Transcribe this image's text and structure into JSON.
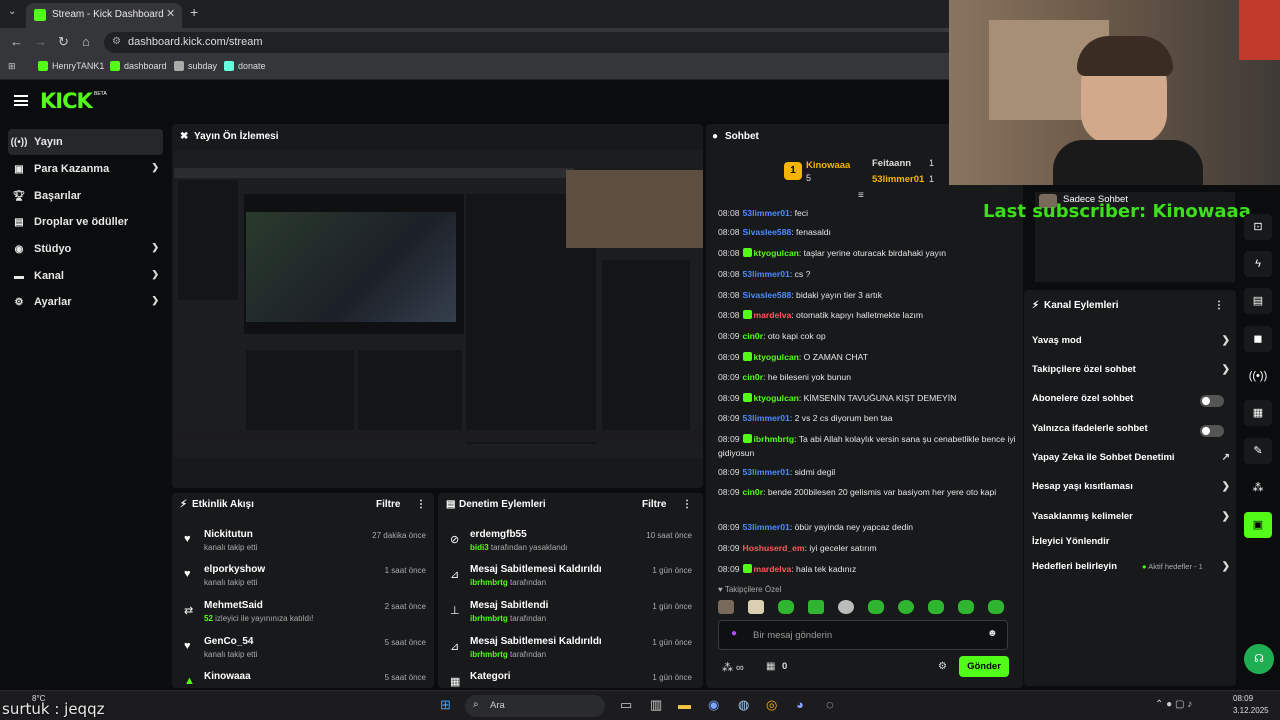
{
  "browser": {
    "tab_title": "Stream - Kick Dashboard",
    "url": "dashboard.kick.com/stream",
    "bookmarks": [
      "HenryTANK1",
      "dashboard",
      "subday",
      "donate"
    ]
  },
  "brand": {
    "logo": "KICK",
    "beta": "BETA",
    "accent": "#53fc18"
  },
  "sidebar": {
    "items": [
      {
        "label": "Yayın",
        "icon": "broadcast-icon",
        "active": true
      },
      {
        "label": "Para Kazanma",
        "icon": "money-icon",
        "chevron": true
      },
      {
        "label": "Başarılar",
        "icon": "trophy-icon"
      },
      {
        "label": "Droplar ve ödüller",
        "icon": "gift-icon"
      },
      {
        "label": "Stüdyo",
        "icon": "studio-icon",
        "chevron": true
      },
      {
        "label": "Kanal",
        "icon": "channel-icon",
        "chevron": true
      },
      {
        "label": "Ayarlar",
        "icon": "gear-icon",
        "chevron": true
      }
    ]
  },
  "preview": {
    "title": "Yayın Ön İzlemesi"
  },
  "activity": {
    "title": "Etkinlik Akışı",
    "filter": "Filtre",
    "rows": [
      {
        "name": "Nickitutun",
        "desc": "kanalı takip etti",
        "time": "27 dakika önce",
        "icon": "heart-icon"
      },
      {
        "name": "elporkyshow",
        "desc": "kanalı takip etti",
        "time": "1 saat önce",
        "icon": "heart-icon"
      },
      {
        "name": "MehmetSaid",
        "count": "52",
        "desc": "izleyici ile yayınınıza katıldı!",
        "time": "2 saat önce",
        "icon": "host-icon"
      },
      {
        "name": "GenCo_54",
        "desc": "kanalı takip etti",
        "time": "5 saat önce",
        "icon": "heart-icon"
      },
      {
        "name": "Kinowaaa",
        "desc": "",
        "time": "5 saat önce",
        "icon": "sub-icon"
      }
    ]
  },
  "moderation": {
    "title": "Denetim Eylemleri",
    "filter": "Filtre",
    "rows": [
      {
        "name": "erdemgfb55",
        "actor": "bidi3",
        "desc": "tarafından yasaklandı",
        "time": "10 saat önce",
        "icon": "ban-icon"
      },
      {
        "name": "Mesaj Sabitlemesi Kaldırıldı",
        "actor": "ibrhmbrtg",
        "desc": "tarafından",
        "time": "1 gün önce",
        "icon": "unpin-icon"
      },
      {
        "name": "Mesaj Sabitlendi",
        "actor": "ibrhmbrtg",
        "desc": "tarafından",
        "time": "1 gün önce",
        "icon": "pin-icon"
      },
      {
        "name": "Mesaj Sabitlemesi Kaldırıldı",
        "actor": "ibrhmbrtg",
        "desc": "tarafından",
        "time": "1 gün önce",
        "icon": "unpin-icon"
      },
      {
        "name": "Kategori",
        "actor": "",
        "desc": "",
        "time": "1 gün önce",
        "icon": "category-icon"
      }
    ]
  },
  "chat": {
    "title": "Sohbet",
    "top_gifters": [
      {
        "name": "Kinowaaa",
        "count": "5",
        "rank": "1"
      },
      {
        "name": "Feitaann",
        "count": "1"
      },
      {
        "name": "53limmer01",
        "count": "1"
      }
    ],
    "messages": [
      {
        "t": "08:08",
        "u": "53limmer01",
        "c": "#4a8cff",
        "m": "feci"
      },
      {
        "t": "08:08",
        "u": "Sivaslee588",
        "c": "#4a8cff",
        "m": "fenasaldı"
      },
      {
        "t": "08:08",
        "u": "ktyogulcan",
        "c": "#53fc18",
        "m": "taşlar yerine oturacak birdahaki yayın",
        "b": true
      },
      {
        "t": "08:08",
        "u": "53limmer01",
        "c": "#4a8cff",
        "m": "cs ?"
      },
      {
        "t": "08:08",
        "u": "Sivaslee588",
        "c": "#4a8cff",
        "m": "bidaki yayın tier 3 artık"
      },
      {
        "t": "08:08",
        "u": "mardelva",
        "c": "#ff5a5a",
        "m": "otomatik kapıyı halletmekte lazım",
        "b": true
      },
      {
        "t": "08:09",
        "u": "cin0r",
        "c": "#53fc18",
        "m": "oto kapi cok op"
      },
      {
        "t": "08:09",
        "u": "ktyogulcan",
        "c": "#53fc18",
        "m": "O ZAMAN CHAT",
        "b": true
      },
      {
        "t": "08:09",
        "u": "cin0r",
        "c": "#53fc18",
        "m": "he bileseni yok bunun"
      },
      {
        "t": "08:09",
        "u": "ktyogulcan",
        "c": "#53fc18",
        "m": "KİMSENİN TAVUĞUNA KIŞT DEMEYİN",
        "b": true
      },
      {
        "t": "08:09",
        "u": "53limmer01",
        "c": "#4a8cff",
        "m": "2 vs 2 cs diyorum ben taa"
      },
      {
        "t": "08:09",
        "u": "ibrhmbrtg",
        "c": "#53fc18",
        "m": "Ta abi Allah kolaylık versin sana şu cenabetlikle bence iyi gidiyosun",
        "b": true
      },
      {
        "t": "08:09",
        "u": "53limmer01",
        "c": "#4a8cff",
        "m": "sidmi degil"
      },
      {
        "t": "08:09",
        "u": "cin0r",
        "c": "#53fc18",
        "m": "bende 200bilesen 20 gelismis var basiyom her yere oto kapi"
      },
      {
        "t": "08:09",
        "u": "53limmer01",
        "c": "#4a8cff",
        "m": "öbür yayinda ney yapcaz dedin"
      },
      {
        "t": "08:09",
        "u": "Hoshuserd_em",
        "c": "#ff5a5a",
        "m": "iyi geceler satırım"
      },
      {
        "t": "08:09",
        "u": "mardelva",
        "c": "#ff5a5a",
        "m": "hala tek kadınız",
        "b": true
      }
    ],
    "followers_only": "Takipçilere Özel",
    "input_placeholder": "Bir mesaj gönderin",
    "points": "0",
    "send": "Gönder"
  },
  "overlay": {
    "text": "Last subscriber: Kinowaaa",
    "cam_label": "Sadece Sohbet",
    "bottom_left": "surtuk : jeqqz"
  },
  "channel_actions": {
    "title": "Kanal Eylemleri",
    "items": [
      {
        "label": "Yavaş mod",
        "kind": "chevron"
      },
      {
        "label": "Takipçilere özel sohbet",
        "kind": "chevron"
      },
      {
        "label": "Abonelere özel sohbet",
        "kind": "toggle"
      },
      {
        "label": "Yalnızca ifadelerle sohbet",
        "kind": "toggle"
      },
      {
        "label": "Yapay Zeka ile Sohbet Denetimi",
        "kind": "external"
      },
      {
        "label": "Hesap yaşı kısıtlaması",
        "kind": "chevron"
      },
      {
        "label": "Yasaklanmış kelimeler",
        "kind": "chevron"
      },
      {
        "label": "İzleyici Yönlendir",
        "kind": "none"
      },
      {
        "label": "Hedefleri belirleyin",
        "kind": "chevron",
        "status": "Aktif hedefler - 1"
      }
    ]
  },
  "taskbar": {
    "search": "Ara",
    "time": "08:09",
    "date": "3.12.2025",
    "weather": "8°C"
  }
}
